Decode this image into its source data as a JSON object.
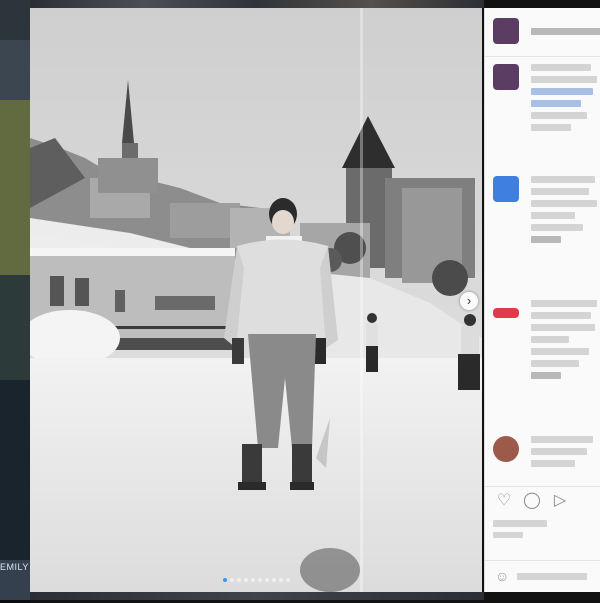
{
  "backdrop": {
    "label": "EMILY"
  },
  "photo": {
    "alt": "",
    "slide_count": 10,
    "active_slide": 0
  },
  "navigation": {
    "next_glyph": "›"
  },
  "side_panel": {
    "header": {
      "username": "",
      "options_glyph": ""
    },
    "comments": [
      {
        "avatar_color": "#5b3d63",
        "text": ""
      },
      {
        "avatar_color": "#3f7fe0",
        "text": ""
      },
      {
        "avatar_color": "#e03a4a",
        "text": ""
      },
      {
        "avatar_color": "#9b5a4a",
        "text": ""
      }
    ],
    "actions": {
      "like_glyph": "♡",
      "comment_glyph": "◯",
      "share_glyph": "▷"
    },
    "add_comment_placeholder": ""
  },
  "colors": {
    "active_dot": "#3897f0",
    "panel_bg": "#fafafa"
  }
}
